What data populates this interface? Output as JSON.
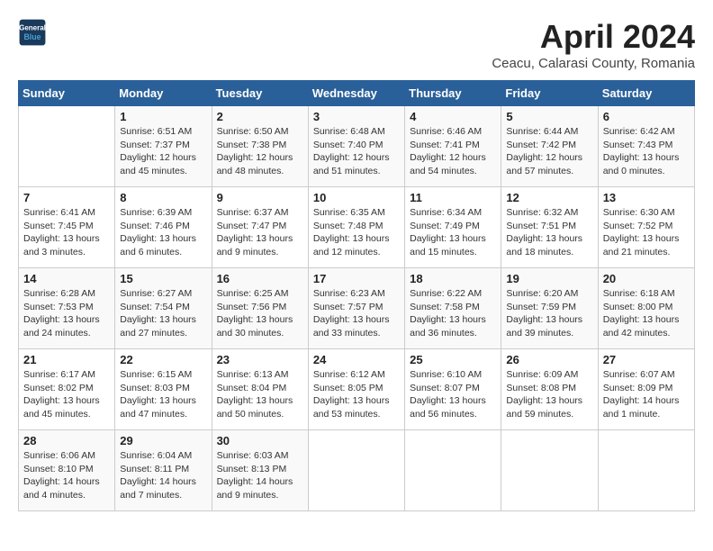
{
  "header": {
    "logo_line1": "General",
    "logo_line2": "Blue",
    "title": "April 2024",
    "subtitle": "Ceacu, Calarasi County, Romania"
  },
  "calendar": {
    "days_of_week": [
      "Sunday",
      "Monday",
      "Tuesday",
      "Wednesday",
      "Thursday",
      "Friday",
      "Saturday"
    ],
    "weeks": [
      [
        {
          "day": "",
          "info": ""
        },
        {
          "day": "1",
          "info": "Sunrise: 6:51 AM\nSunset: 7:37 PM\nDaylight: 12 hours\nand 45 minutes."
        },
        {
          "day": "2",
          "info": "Sunrise: 6:50 AM\nSunset: 7:38 PM\nDaylight: 12 hours\nand 48 minutes."
        },
        {
          "day": "3",
          "info": "Sunrise: 6:48 AM\nSunset: 7:40 PM\nDaylight: 12 hours\nand 51 minutes."
        },
        {
          "day": "4",
          "info": "Sunrise: 6:46 AM\nSunset: 7:41 PM\nDaylight: 12 hours\nand 54 minutes."
        },
        {
          "day": "5",
          "info": "Sunrise: 6:44 AM\nSunset: 7:42 PM\nDaylight: 12 hours\nand 57 minutes."
        },
        {
          "day": "6",
          "info": "Sunrise: 6:42 AM\nSunset: 7:43 PM\nDaylight: 13 hours\nand 0 minutes."
        }
      ],
      [
        {
          "day": "7",
          "info": "Sunrise: 6:41 AM\nSunset: 7:45 PM\nDaylight: 13 hours\nand 3 minutes."
        },
        {
          "day": "8",
          "info": "Sunrise: 6:39 AM\nSunset: 7:46 PM\nDaylight: 13 hours\nand 6 minutes."
        },
        {
          "day": "9",
          "info": "Sunrise: 6:37 AM\nSunset: 7:47 PM\nDaylight: 13 hours\nand 9 minutes."
        },
        {
          "day": "10",
          "info": "Sunrise: 6:35 AM\nSunset: 7:48 PM\nDaylight: 13 hours\nand 12 minutes."
        },
        {
          "day": "11",
          "info": "Sunrise: 6:34 AM\nSunset: 7:49 PM\nDaylight: 13 hours\nand 15 minutes."
        },
        {
          "day": "12",
          "info": "Sunrise: 6:32 AM\nSunset: 7:51 PM\nDaylight: 13 hours\nand 18 minutes."
        },
        {
          "day": "13",
          "info": "Sunrise: 6:30 AM\nSunset: 7:52 PM\nDaylight: 13 hours\nand 21 minutes."
        }
      ],
      [
        {
          "day": "14",
          "info": "Sunrise: 6:28 AM\nSunset: 7:53 PM\nDaylight: 13 hours\nand 24 minutes."
        },
        {
          "day": "15",
          "info": "Sunrise: 6:27 AM\nSunset: 7:54 PM\nDaylight: 13 hours\nand 27 minutes."
        },
        {
          "day": "16",
          "info": "Sunrise: 6:25 AM\nSunset: 7:56 PM\nDaylight: 13 hours\nand 30 minutes."
        },
        {
          "day": "17",
          "info": "Sunrise: 6:23 AM\nSunset: 7:57 PM\nDaylight: 13 hours\nand 33 minutes."
        },
        {
          "day": "18",
          "info": "Sunrise: 6:22 AM\nSunset: 7:58 PM\nDaylight: 13 hours\nand 36 minutes."
        },
        {
          "day": "19",
          "info": "Sunrise: 6:20 AM\nSunset: 7:59 PM\nDaylight: 13 hours\nand 39 minutes."
        },
        {
          "day": "20",
          "info": "Sunrise: 6:18 AM\nSunset: 8:00 PM\nDaylight: 13 hours\nand 42 minutes."
        }
      ],
      [
        {
          "day": "21",
          "info": "Sunrise: 6:17 AM\nSunset: 8:02 PM\nDaylight: 13 hours\nand 45 minutes."
        },
        {
          "day": "22",
          "info": "Sunrise: 6:15 AM\nSunset: 8:03 PM\nDaylight: 13 hours\nand 47 minutes."
        },
        {
          "day": "23",
          "info": "Sunrise: 6:13 AM\nSunset: 8:04 PM\nDaylight: 13 hours\nand 50 minutes."
        },
        {
          "day": "24",
          "info": "Sunrise: 6:12 AM\nSunset: 8:05 PM\nDaylight: 13 hours\nand 53 minutes."
        },
        {
          "day": "25",
          "info": "Sunrise: 6:10 AM\nSunset: 8:07 PM\nDaylight: 13 hours\nand 56 minutes."
        },
        {
          "day": "26",
          "info": "Sunrise: 6:09 AM\nSunset: 8:08 PM\nDaylight: 13 hours\nand 59 minutes."
        },
        {
          "day": "27",
          "info": "Sunrise: 6:07 AM\nSunset: 8:09 PM\nDaylight: 14 hours\nand 1 minute."
        }
      ],
      [
        {
          "day": "28",
          "info": "Sunrise: 6:06 AM\nSunset: 8:10 PM\nDaylight: 14 hours\nand 4 minutes."
        },
        {
          "day": "29",
          "info": "Sunrise: 6:04 AM\nSunset: 8:11 PM\nDaylight: 14 hours\nand 7 minutes."
        },
        {
          "day": "30",
          "info": "Sunrise: 6:03 AM\nSunset: 8:13 PM\nDaylight: 14 hours\nand 9 minutes."
        },
        {
          "day": "",
          "info": ""
        },
        {
          "day": "",
          "info": ""
        },
        {
          "day": "",
          "info": ""
        },
        {
          "day": "",
          "info": ""
        }
      ]
    ]
  }
}
